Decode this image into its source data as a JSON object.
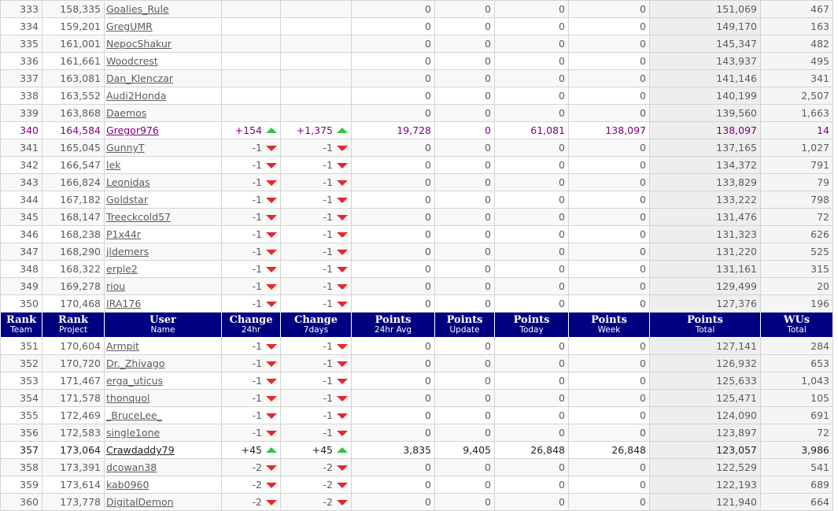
{
  "header": {
    "rank_team": {
      "main": "Rank",
      "sub": "Team"
    },
    "rank_project": {
      "main": "Rank",
      "sub": "Project"
    },
    "user": {
      "main": "User",
      "sub": "Name"
    },
    "change_24hr": {
      "main": "Change",
      "sub": "24hr"
    },
    "change_7days": {
      "main": "Change",
      "sub": "7days"
    },
    "points_avg": {
      "main": "Points",
      "sub": "24hr Avg"
    },
    "points_update": {
      "main": "Points",
      "sub": "Update"
    },
    "points_today": {
      "main": "Points",
      "sub": "Today"
    },
    "points_week": {
      "main": "Points",
      "sub": "Week"
    },
    "points_total": {
      "main": "Points",
      "sub": "Total"
    },
    "wus_total": {
      "main": "WUs",
      "sub": "Total"
    }
  },
  "colors": {
    "header_bg": "#000080",
    "highlight_text": "#800080",
    "arrow_down": "#e8262c",
    "arrow_up": "#2ec73a"
  },
  "rows_a": [
    {
      "rank": "333",
      "project": "158,335",
      "user": "Goalies_Rule",
      "c24": "",
      "d24": "",
      "c7": "",
      "d7": "",
      "avg": "0",
      "update": "0",
      "today": "0",
      "week": "0",
      "total": "151,069",
      "wus": "467"
    },
    {
      "rank": "334",
      "project": "159,201",
      "user": "GregUMR",
      "c24": "",
      "d24": "",
      "c7": "",
      "d7": "",
      "avg": "0",
      "update": "0",
      "today": "0",
      "week": "0",
      "total": "149,170",
      "wus": "163"
    },
    {
      "rank": "335",
      "project": "161,001",
      "user": "NepocShakur",
      "c24": "",
      "d24": "",
      "c7": "",
      "d7": "",
      "avg": "0",
      "update": "0",
      "today": "0",
      "week": "0",
      "total": "145,347",
      "wus": "482"
    },
    {
      "rank": "336",
      "project": "161,661",
      "user": "Woodcrest",
      "c24": "",
      "d24": "",
      "c7": "",
      "d7": "",
      "avg": "0",
      "update": "0",
      "today": "0",
      "week": "0",
      "total": "143,937",
      "wus": "495"
    },
    {
      "rank": "337",
      "project": "163,081",
      "user": "Dan_Klenczar",
      "c24": "",
      "d24": "",
      "c7": "",
      "d7": "",
      "avg": "0",
      "update": "0",
      "today": "0",
      "week": "0",
      "total": "141,146",
      "wus": "341"
    },
    {
      "rank": "338",
      "project": "163,552",
      "user": "Audi2Honda",
      "c24": "",
      "d24": "",
      "c7": "",
      "d7": "",
      "avg": "0",
      "update": "0",
      "today": "0",
      "week": "0",
      "total": "140,199",
      "wus": "2,507"
    },
    {
      "rank": "339",
      "project": "163,868",
      "user": "Daemos",
      "c24": "",
      "d24": "",
      "c7": "",
      "d7": "",
      "avg": "0",
      "update": "0",
      "today": "0",
      "week": "0",
      "total": "139,560",
      "wus": "1,663"
    },
    {
      "rank": "340",
      "project": "164,584",
      "user": "Gregor976",
      "c24": "+154",
      "d24": "up",
      "c7": "+1,375",
      "d7": "up",
      "avg": "19,728",
      "update": "0",
      "today": "61,081",
      "week": "138,097",
      "total": "138,097",
      "wus": "14",
      "cls": "hl"
    },
    {
      "rank": "341",
      "project": "165,045",
      "user": "GunnyT",
      "c24": "-1",
      "d24": "down",
      "c7": "-1",
      "d7": "down",
      "avg": "0",
      "update": "0",
      "today": "0",
      "week": "0",
      "total": "137,165",
      "wus": "1,027"
    },
    {
      "rank": "342",
      "project": "166,547",
      "user": "lek",
      "c24": "-1",
      "d24": "down",
      "c7": "-1",
      "d7": "down",
      "avg": "0",
      "update": "0",
      "today": "0",
      "week": "0",
      "total": "134,372",
      "wus": "791"
    },
    {
      "rank": "343",
      "project": "166,824",
      "user": "Leonidas",
      "c24": "-1",
      "d24": "down",
      "c7": "-1",
      "d7": "down",
      "avg": "0",
      "update": "0",
      "today": "0",
      "week": "0",
      "total": "133,829",
      "wus": "79"
    },
    {
      "rank": "344",
      "project": "167,182",
      "user": "Goldstar",
      "c24": "-1",
      "d24": "down",
      "c7": "-1",
      "d7": "down",
      "avg": "0",
      "update": "0",
      "today": "0",
      "week": "0",
      "total": "133,222",
      "wus": "798"
    },
    {
      "rank": "345",
      "project": "168,147",
      "user": "Treeckcold57",
      "c24": "-1",
      "d24": "down",
      "c7": "-1",
      "d7": "down",
      "avg": "0",
      "update": "0",
      "today": "0",
      "week": "0",
      "total": "131,476",
      "wus": "72"
    },
    {
      "rank": "346",
      "project": "168,238",
      "user": "P1x44r",
      "c24": "-1",
      "d24": "down",
      "c7": "-1",
      "d7": "down",
      "avg": "0",
      "update": "0",
      "today": "0",
      "week": "0",
      "total": "131,323",
      "wus": "626"
    },
    {
      "rank": "347",
      "project": "168,290",
      "user": "jldemers",
      "c24": "-1",
      "d24": "down",
      "c7": "-1",
      "d7": "down",
      "avg": "0",
      "update": "0",
      "today": "0",
      "week": "0",
      "total": "131,220",
      "wus": "525"
    },
    {
      "rank": "348",
      "project": "168,322",
      "user": "erple2",
      "c24": "-1",
      "d24": "down",
      "c7": "-1",
      "d7": "down",
      "avg": "0",
      "update": "0",
      "today": "0",
      "week": "0",
      "total": "131,161",
      "wus": "315"
    },
    {
      "rank": "349",
      "project": "169,278",
      "user": "riou",
      "c24": "-1",
      "d24": "down",
      "c7": "-1",
      "d7": "down",
      "avg": "0",
      "update": "0",
      "today": "0",
      "week": "0",
      "total": "129,499",
      "wus": "20"
    },
    {
      "rank": "350",
      "project": "170,468",
      "user": "IRA176",
      "c24": "-1",
      "d24": "down",
      "c7": "-1",
      "d7": "down",
      "avg": "0",
      "update": "0",
      "today": "0",
      "week": "0",
      "total": "127,376",
      "wus": "196"
    }
  ],
  "rows_b": [
    {
      "rank": "351",
      "project": "170,604",
      "user": "Armpit",
      "c24": "-1",
      "d24": "down",
      "c7": "-1",
      "d7": "down",
      "avg": "0",
      "update": "0",
      "today": "0",
      "week": "0",
      "total": "127,141",
      "wus": "284"
    },
    {
      "rank": "352",
      "project": "170,720",
      "user": "Dr._Zhivago",
      "c24": "-1",
      "d24": "down",
      "c7": "-1",
      "d7": "down",
      "avg": "0",
      "update": "0",
      "today": "0",
      "week": "0",
      "total": "126,932",
      "wus": "653"
    },
    {
      "rank": "353",
      "project": "171,467",
      "user": "erga_uticus",
      "c24": "-1",
      "d24": "down",
      "c7": "-1",
      "d7": "down",
      "avg": "0",
      "update": "0",
      "today": "0",
      "week": "0",
      "total": "125,633",
      "wus": "1,043"
    },
    {
      "rank": "354",
      "project": "171,578",
      "user": "thonquol",
      "c24": "-1",
      "d24": "down",
      "c7": "-1",
      "d7": "down",
      "avg": "0",
      "update": "0",
      "today": "0",
      "week": "0",
      "total": "125,471",
      "wus": "105"
    },
    {
      "rank": "355",
      "project": "172,469",
      "user": "_BruceLee_",
      "c24": "-1",
      "d24": "down",
      "c7": "-1",
      "d7": "down",
      "avg": "0",
      "update": "0",
      "today": "0",
      "week": "0",
      "total": "124,090",
      "wus": "691"
    },
    {
      "rank": "356",
      "project": "172,583",
      "user": "single1one",
      "c24": "-1",
      "d24": "down",
      "c7": "-1",
      "d7": "down",
      "avg": "0",
      "update": "0",
      "today": "0",
      "week": "0",
      "total": "123,897",
      "wus": "72"
    },
    {
      "rank": "357",
      "project": "173,064",
      "user": "Crawdaddy79",
      "c24": "+45",
      "d24": "up",
      "c7": "+45",
      "d7": "up",
      "avg": "3,835",
      "update": "9,405",
      "today": "26,848",
      "week": "26,848",
      "total": "123,057",
      "wus": "3,986",
      "cls": "dark"
    },
    {
      "rank": "358",
      "project": "173,391",
      "user": "dcowan38",
      "c24": "-2",
      "d24": "down",
      "c7": "-2",
      "d7": "down",
      "avg": "0",
      "update": "0",
      "today": "0",
      "week": "0",
      "total": "122,529",
      "wus": "541"
    },
    {
      "rank": "359",
      "project": "173,614",
      "user": "kab0960",
      "c24": "-2",
      "d24": "down",
      "c7": "-2",
      "d7": "down",
      "avg": "0",
      "update": "0",
      "today": "0",
      "week": "0",
      "total": "122,193",
      "wus": "689"
    },
    {
      "rank": "360",
      "project": "173,778",
      "user": "DigitalDemon",
      "c24": "-2",
      "d24": "down",
      "c7": "-2",
      "d7": "down",
      "avg": "0",
      "update": "0",
      "today": "0",
      "week": "0",
      "total": "121,940",
      "wus": "664"
    }
  ]
}
